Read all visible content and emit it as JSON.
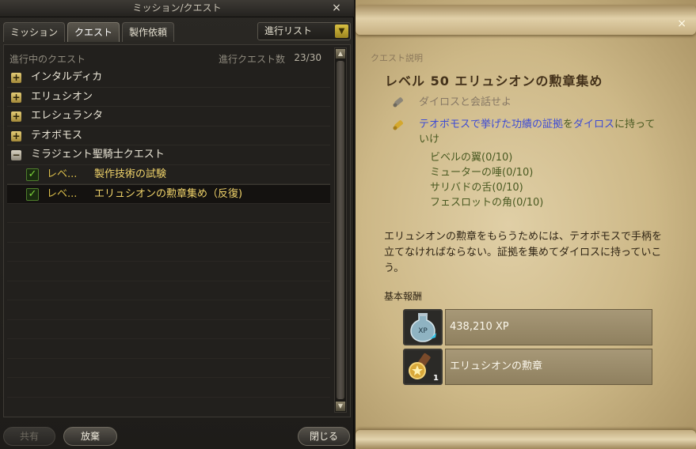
{
  "window": {
    "title": "ミッション/クエスト",
    "close_glyph": "×"
  },
  "tabs": [
    {
      "label": "ミッション",
      "active": false
    },
    {
      "label": "クエスト",
      "active": true
    },
    {
      "label": "製作依頼",
      "active": false
    }
  ],
  "filter": {
    "selected": "進行リスト"
  },
  "list": {
    "header": "進行中のクエスト",
    "count_label": "進行クエスト数",
    "count_value": "23/30",
    "groups": [
      {
        "label": "インタルディカ",
        "state": "collapsed",
        "toggle": "+"
      },
      {
        "label": "エリュシオン",
        "state": "collapsed",
        "toggle": "+"
      },
      {
        "label": "エレシュランタ",
        "state": "collapsed",
        "toggle": "+"
      },
      {
        "label": "テオボモス",
        "state": "collapsed",
        "toggle": "+"
      },
      {
        "label": "ミラジェント聖騎士クエスト",
        "state": "expanded",
        "toggle": "−"
      }
    ],
    "quests": [
      {
        "level": "レベ...",
        "name": "製作技術の試験",
        "checked": true
      },
      {
        "level": "レベ...",
        "name": "エリュシオンの勲章集め（反復)",
        "checked": true,
        "selected": true
      }
    ]
  },
  "buttons": {
    "share": "共有",
    "abandon": "放棄",
    "close": "閉じる"
  },
  "detail": {
    "section_label": "クエスト説明",
    "title": "レベル 50 エリュシオンの勲章集め",
    "objective1": "ダイロスと会話せよ",
    "objective2": {
      "a": "テオボモスで挙げた功績の証拠",
      "b": "を",
      "c": "ダイロス",
      "d": "に持っていけ"
    },
    "items": [
      "ビベルの翼(0/10)",
      "ミューターの唾(0/10)",
      "サリバドの舌(0/10)",
      "フェスロットの角(0/10)"
    ],
    "description": "エリュシオンの勲章をもらうためには、テオボモスで手柄を立てなければならない。証拠を集めてダイロスに持っていこう。",
    "reward_label": "基本報酬",
    "rewards": [
      {
        "icon": "xp-potion-icon",
        "text": "438,210  XP"
      },
      {
        "icon": "medal-icon",
        "text": "エリュシオンの勲章",
        "qty": "1"
      }
    ]
  }
}
